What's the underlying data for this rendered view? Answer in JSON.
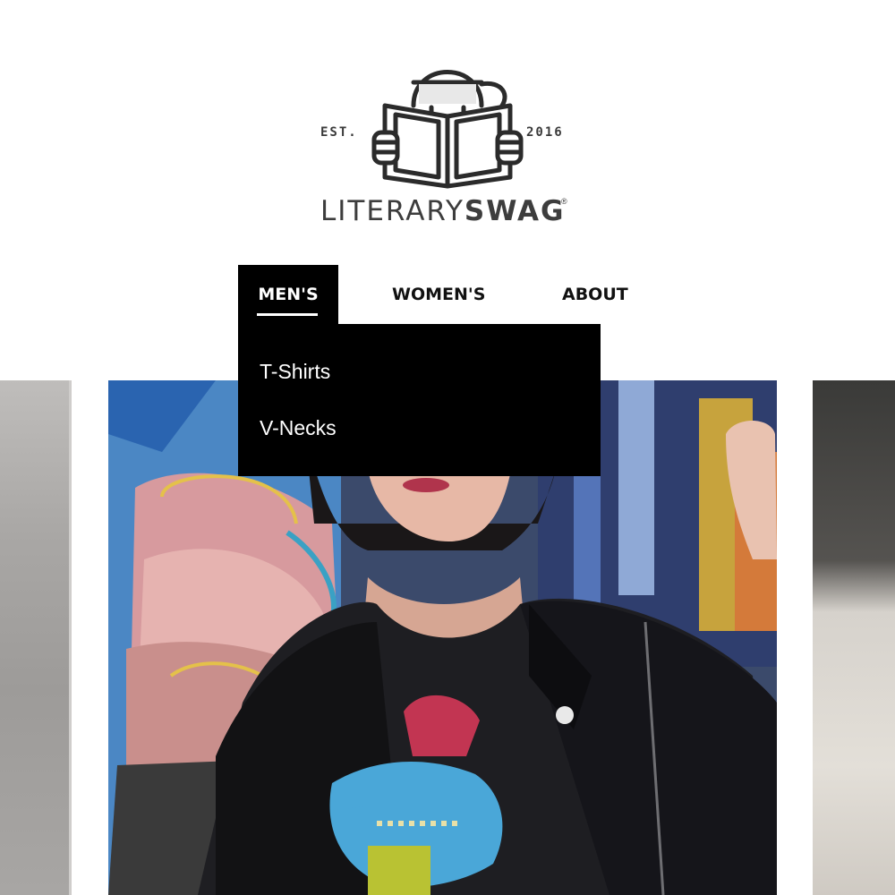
{
  "logo": {
    "est": "EST.",
    "year": "2016",
    "brand_light": "LITERARY",
    "brand_bold": "SWAG",
    "registered": "®",
    "icon": "reader-mascot-icon"
  },
  "nav": {
    "items": [
      {
        "label": "MEN'S",
        "active": true
      },
      {
        "label": "WOMEN'S",
        "active": false
      },
      {
        "label": "ABOUT",
        "active": false
      }
    ]
  },
  "dropdown": {
    "items": [
      {
        "label": "T-Shirts"
      },
      {
        "label": "V-Necks"
      }
    ]
  },
  "colors": {
    "nav_active_bg": "#000000",
    "dropdown_bg": "#000000",
    "text": "#111111"
  }
}
